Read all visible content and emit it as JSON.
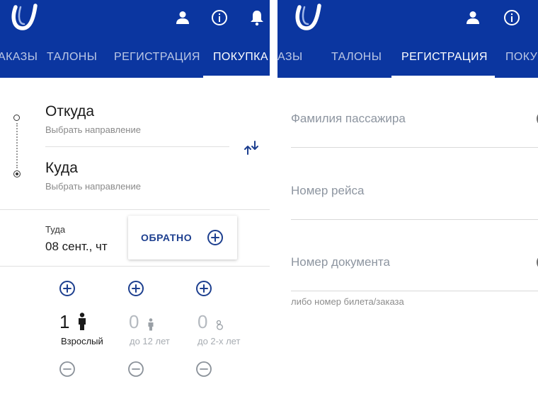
{
  "colors": {
    "appbar": "#0b36a0",
    "accent": "#1d3f8f",
    "muted": "#8d95a0"
  },
  "left": {
    "header_icons": [
      "logo-icon",
      "user-icon",
      "info-icon",
      "bell-icon"
    ],
    "tabs": [
      {
        "label": "АКАЗЫ"
      },
      {
        "label": "ТАЛОНЫ"
      },
      {
        "label": "РЕГИСТРАЦИЯ"
      },
      {
        "label": "ПОКУПКА",
        "active": true
      }
    ],
    "from": {
      "title": "Откуда",
      "placeholder": "Выбрать направление"
    },
    "to": {
      "title": "Куда",
      "placeholder": "Выбрать направление"
    },
    "depart": {
      "label": "Туда",
      "value": "08 сент., чт"
    },
    "return_label": "ОБРАТНО",
    "passengers": [
      {
        "count": "1",
        "label": "Взрослый",
        "icon": "adult-icon"
      },
      {
        "count": "0",
        "label": "до 12 лет",
        "icon": "child-icon"
      },
      {
        "count": "0",
        "label": "до 2-х лет",
        "icon": "infant-icon"
      }
    ]
  },
  "right": {
    "header_icons": [
      "logo-icon",
      "user-icon",
      "info-icon"
    ],
    "tabs": [
      {
        "label": "АЗЫ"
      },
      {
        "label": "ТАЛОНЫ"
      },
      {
        "label": "РЕГИСТРАЦИЯ",
        "active": true
      },
      {
        "label": "ПОКУ"
      }
    ],
    "fields": [
      {
        "label": "Фамилия пассажира"
      },
      {
        "label": "Номер рейса"
      },
      {
        "label": "Номер документа"
      }
    ],
    "hint": "либо номер билета/заказа"
  }
}
